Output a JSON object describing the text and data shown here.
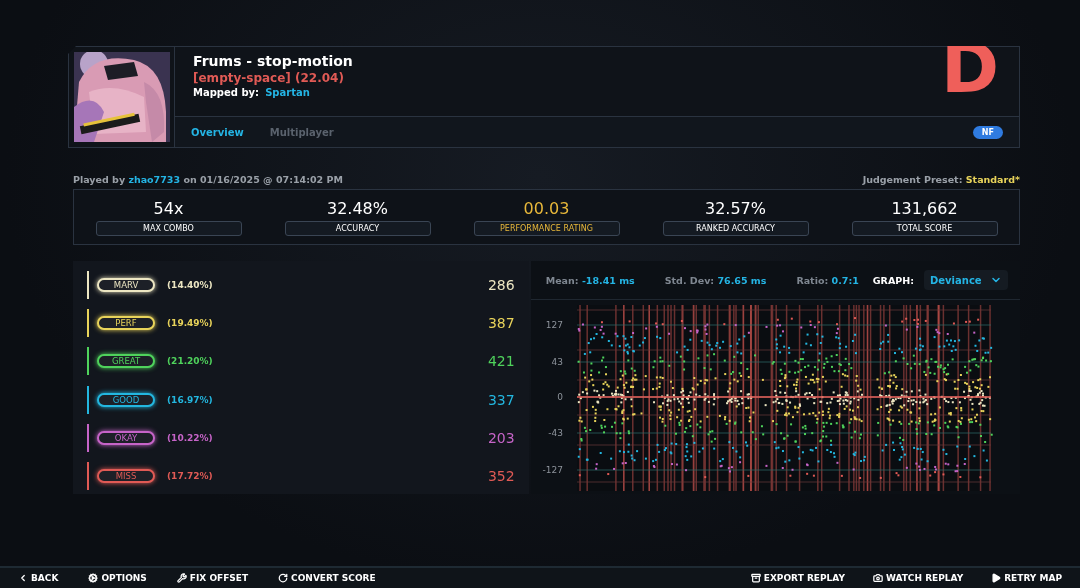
{
  "header": {
    "title": "Frums - stop-motion",
    "difficulty": "[empty-space] (22.04)",
    "mapper_label": "Mapped by:",
    "mapper": "Spartan",
    "grade": "D",
    "tabs": [
      {
        "label": "Overview",
        "selected": true
      },
      {
        "label": "Multiplayer",
        "selected": false
      }
    ],
    "modifiers": [
      "NF"
    ]
  },
  "played": {
    "prefix": "Played by",
    "player": "zhao7733",
    "date": "on 01/16/2025 @ 07:14:02 PM",
    "preset_label": "Judgement Preset:",
    "preset": "Standard*"
  },
  "stats": [
    {
      "value": "54x",
      "label": "MAX COMBO",
      "highlight": false
    },
    {
      "value": "32.48%",
      "label": "ACCURACY",
      "highlight": false
    },
    {
      "value": "00.03",
      "label": "PERFORMANCE RATING",
      "highlight": true
    },
    {
      "value": "32.57%",
      "label": "RANKED ACCURACY",
      "highlight": false
    },
    {
      "value": "131,662",
      "label": "TOTAL SCORE",
      "highlight": false
    }
  ],
  "judgements": [
    {
      "name": "MARV",
      "percent": "(14.40%)",
      "count": "286",
      "color": "#ece6c2"
    },
    {
      "name": "PERF",
      "percent": "(19.49%)",
      "count": "387",
      "color": "#e8d35a"
    },
    {
      "name": "GREAT",
      "percent": "(21.20%)",
      "count": "421",
      "color": "#4fd35c"
    },
    {
      "name": "GOOD",
      "percent": "(16.97%)",
      "count": "337",
      "color": "#23b7e0"
    },
    {
      "name": "OKAY",
      "percent": "(10.22%)",
      "count": "203",
      "color": "#c664c8"
    },
    {
      "name": "MISS",
      "percent": "(17.72%)",
      "count": "352",
      "color": "#e05a55"
    }
  ],
  "graph": {
    "mean_label": "Mean:",
    "mean": "-18.41 ms",
    "std_label": "Std. Dev:",
    "std": "76.65 ms",
    "ratio_label": "Ratio:",
    "ratio": "0.7:1",
    "graph_label": "GRAPH:",
    "graph_mode": "Deviance",
    "yticks": [
      "127",
      "43",
      "0",
      "-43",
      "-127"
    ]
  },
  "footer": {
    "left": [
      {
        "label": "BACK",
        "kind": "back"
      },
      {
        "label": "OPTIONS",
        "kind": "options"
      },
      {
        "label": "FIX OFFSET",
        "kind": "wrench"
      },
      {
        "label": "CONVERT SCORE",
        "kind": "convert"
      }
    ],
    "right": [
      {
        "label": "EXPORT REPLAY",
        "kind": "export"
      },
      {
        "label": "WATCH REPLAY",
        "kind": "camera"
      },
      {
        "label": "RETRY MAP",
        "kind": "play"
      }
    ]
  }
}
